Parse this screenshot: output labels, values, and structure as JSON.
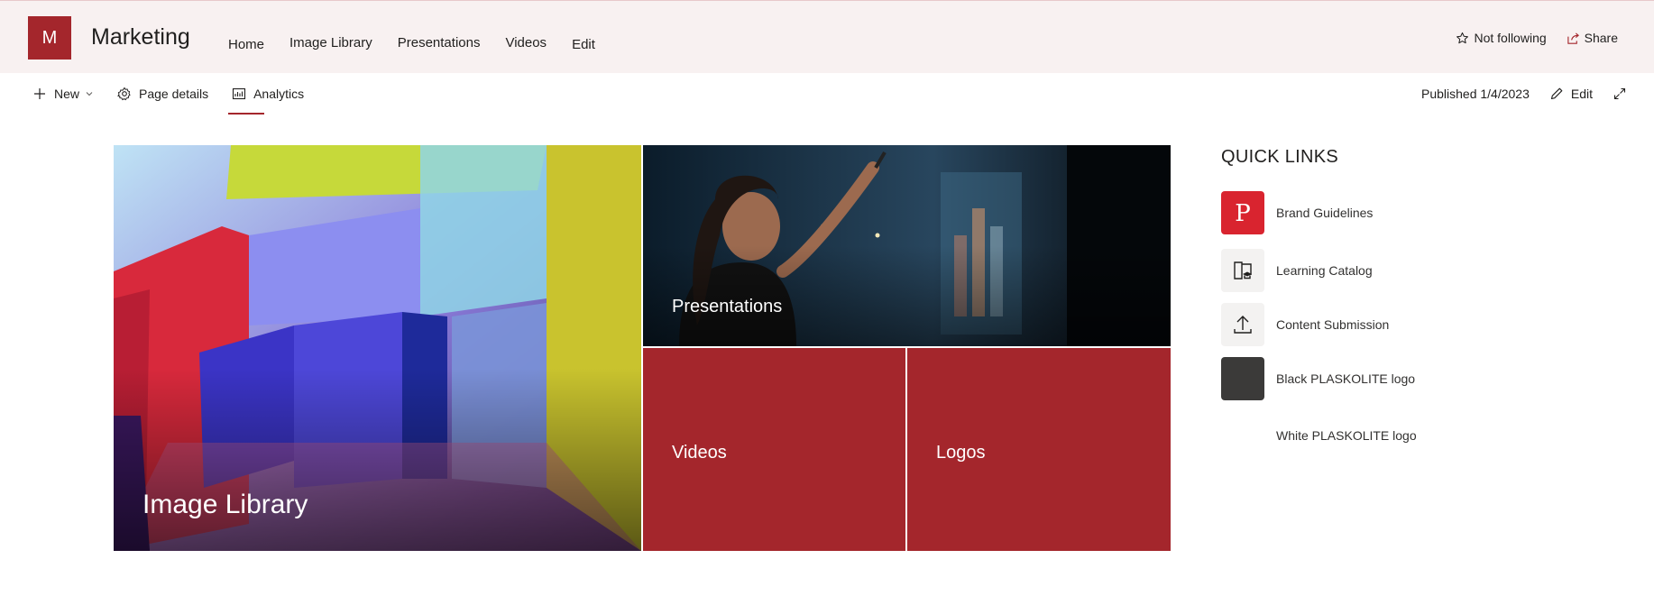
{
  "site": {
    "logo_letter": "M",
    "title": "Marketing",
    "nav": [
      {
        "label": "Home",
        "active": true
      },
      {
        "label": "Image Library"
      },
      {
        "label": "Presentations"
      },
      {
        "label": "Videos"
      },
      {
        "label": "Edit"
      }
    ],
    "actions": {
      "follow_label": "Not following",
      "share_label": "Share"
    }
  },
  "command_bar": {
    "new_label": "New",
    "page_details_label": "Page details",
    "analytics_label": "Analytics",
    "published_text": "Published 1/4/2023",
    "edit_label": "Edit"
  },
  "hero": {
    "tiles": [
      {
        "label": "Image Library"
      },
      {
        "label": "Presentations"
      },
      {
        "label": "Videos"
      },
      {
        "label": "Logos"
      }
    ]
  },
  "quick_links": {
    "title": "QUICK LINKS",
    "items": [
      {
        "label": "Brand Guidelines",
        "icon": "pdf-icon"
      },
      {
        "label": "Learning Catalog",
        "icon": "learning-catalog-icon"
      },
      {
        "label": "Content Submission",
        "icon": "upload-icon"
      },
      {
        "label": "Black PLASKOLITE logo",
        "icon": "black-logo-thumbnail"
      },
      {
        "label": "White PLASKOLITE logo",
        "icon": "white-logo-thumbnail"
      }
    ]
  },
  "colors": {
    "brand": "#a4262c",
    "header_bg": "#f8f1f1"
  }
}
